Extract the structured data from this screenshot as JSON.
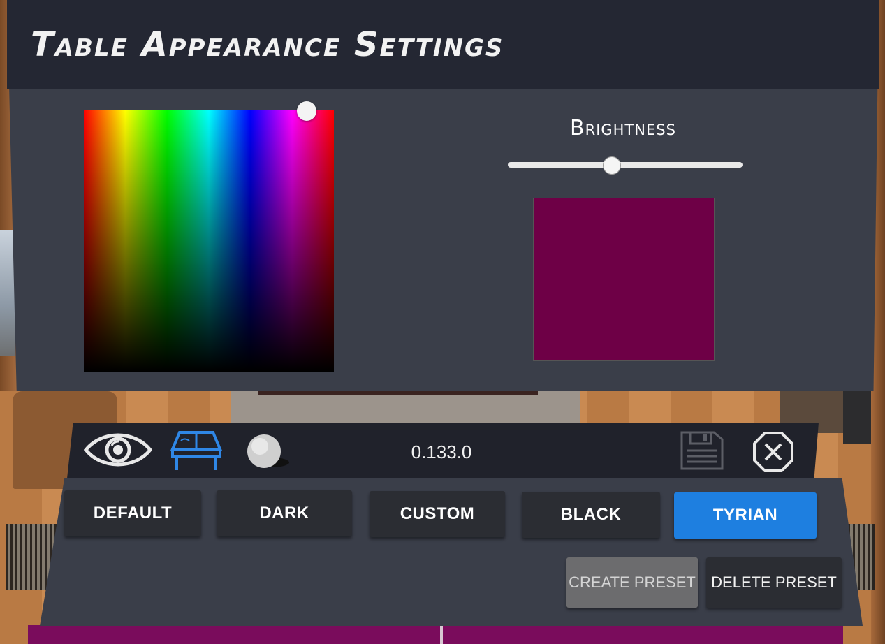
{
  "header": {
    "title": "Table Appearance Settings"
  },
  "color_picker": {
    "selected_hue_icon": "hue-saturation-handle"
  },
  "brightness": {
    "label": "Brightness",
    "value_fraction": 0.44
  },
  "preview": {
    "color": "#6e0046"
  },
  "toolbar": {
    "icons": [
      "eye-icon",
      "table-icon",
      "ball-icon",
      "save-icon",
      "close-icon"
    ],
    "active_icon": "table-icon",
    "version": "0.133.0"
  },
  "presets": {
    "items": [
      "DEFAULT",
      "DARK",
      "CUSTOM",
      "BLACK",
      "TYRIAN"
    ],
    "selected": "TYRIAN"
  },
  "actions": {
    "create_label": "CREATE PRESET",
    "delete_label": "DELETE PRESET"
  },
  "colors": {
    "panel": "#3a3e49",
    "header": "#242733",
    "accent": "#1e7fe0",
    "button": "#2b2d33"
  }
}
